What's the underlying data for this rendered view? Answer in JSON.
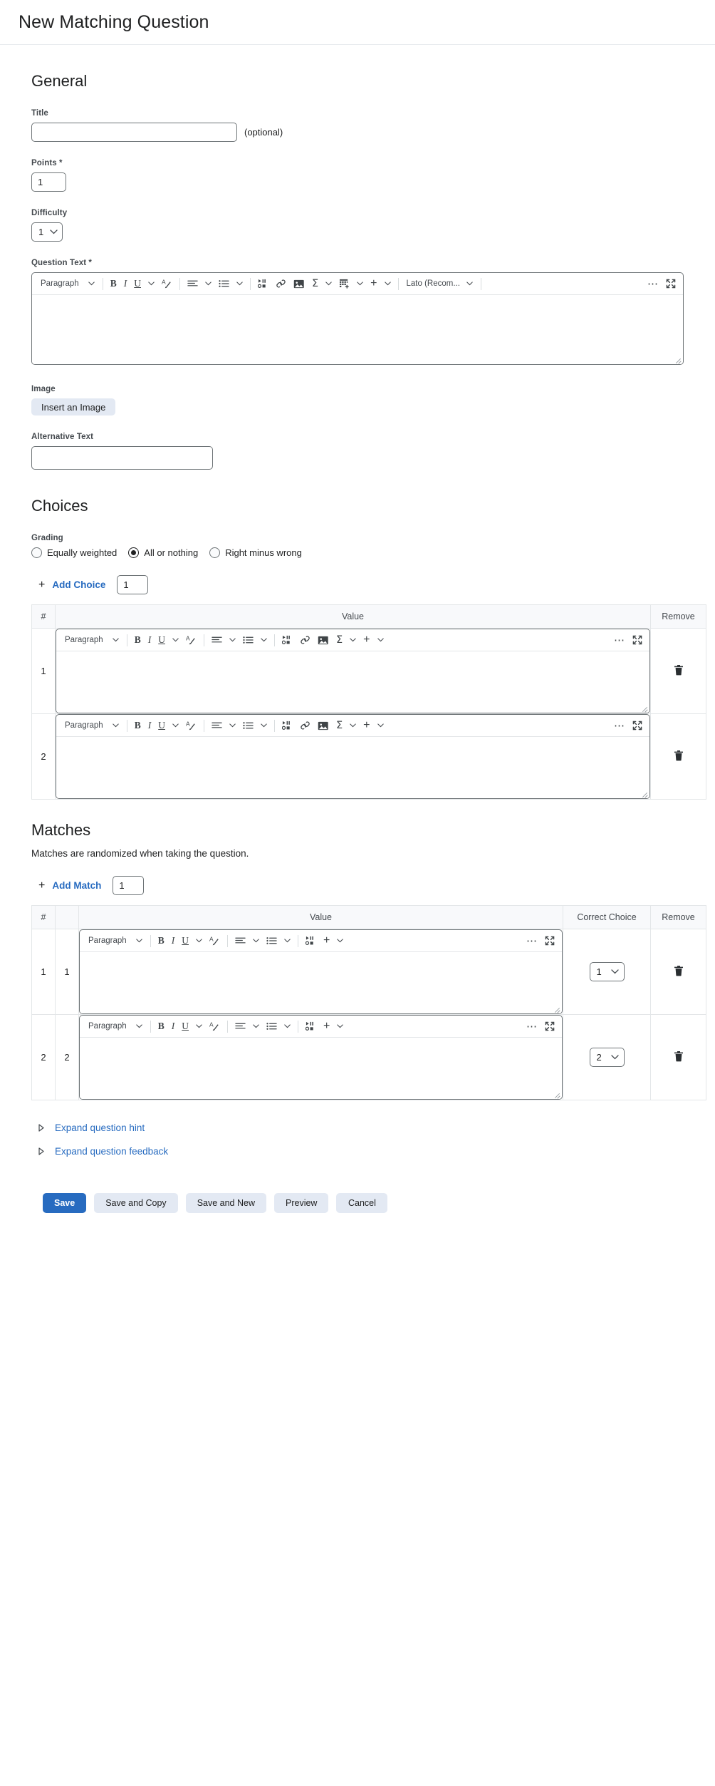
{
  "header": {
    "title": "New Matching Question"
  },
  "general": {
    "section_title": "General",
    "title_label": "Title",
    "title_value": "",
    "title_optional_note": "(optional)",
    "points_label": "Points *",
    "points_value": "1",
    "difficulty_label": "Difficulty",
    "difficulty_value": "1",
    "question_text_label": "Question Text *",
    "image_label": "Image",
    "insert_image_label": "Insert an Image",
    "alt_text_label": "Alternative Text",
    "alt_text_value": ""
  },
  "editor_main": {
    "paragraph_label": "Paragraph",
    "font_label": "Lato (Recom...",
    "tools": [
      "bold-icon",
      "italic-icon",
      "underline-icon",
      "text-color-icon",
      "align-icon",
      "list-icon",
      "media-icon",
      "link-icon",
      "image-icon",
      "equation-icon",
      "table-icon",
      "insert-icon",
      "more-options-icon",
      "fullscreen-icon"
    ]
  },
  "choices": {
    "section_title": "Choices",
    "grading_label": "Grading",
    "grading_options": [
      {
        "label": "Equally weighted",
        "selected": false
      },
      {
        "label": "All or nothing",
        "selected": true
      },
      {
        "label": "Right minus wrong",
        "selected": false
      }
    ],
    "add_label": "Add Choice",
    "add_count": "1",
    "columns": [
      "#",
      "Value",
      "Remove"
    ],
    "rows": [
      {
        "num": "1",
        "value": ""
      },
      {
        "num": "2",
        "value": ""
      }
    ]
  },
  "choice_editor": {
    "paragraph_label": "Paragraph"
  },
  "matches": {
    "section_title": "Matches",
    "note": "Matches are randomized when taking the question.",
    "add_label": "Add Match",
    "add_count": "1",
    "columns": [
      "#",
      "",
      "Value",
      "Correct Choice",
      "Remove"
    ],
    "rows": [
      {
        "num": "1",
        "index": "1",
        "value": "",
        "correct_choice": "1"
      },
      {
        "num": "2",
        "index": "2",
        "value": "",
        "correct_choice": "2"
      }
    ]
  },
  "expand": {
    "hint_label": "Expand question hint",
    "feedback_label": "Expand question feedback"
  },
  "footer": {
    "save_label": "Save",
    "save_copy_label": "Save and Copy",
    "save_new_label": "Save and New",
    "preview_label": "Preview",
    "cancel_label": "Cancel"
  },
  "colors": {
    "accent": "#276bc0",
    "border": "#6e7477",
    "table_header_bg": "#f8f9fb"
  }
}
